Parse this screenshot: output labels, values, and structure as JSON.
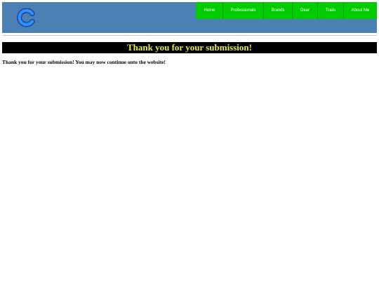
{
  "colors": {
    "header_bg": "#4a80b3",
    "nav_bg": "#00cc00",
    "banner_bg": "#000000",
    "banner_text": "#e8e85a",
    "logo_fill": "#2f8fff"
  },
  "header": {
    "logo_icon": "letter-c-logo-icon"
  },
  "nav": {
    "items": [
      {
        "label": "Home"
      },
      {
        "label": "Professionals"
      },
      {
        "label": "Brands"
      },
      {
        "label": "Gear"
      },
      {
        "label": "Trails"
      },
      {
        "label": "About Me"
      }
    ]
  },
  "main": {
    "banner_title": "Thank you for your submission!",
    "message": "Thank you for your submission! You may now continue onto the website!"
  }
}
